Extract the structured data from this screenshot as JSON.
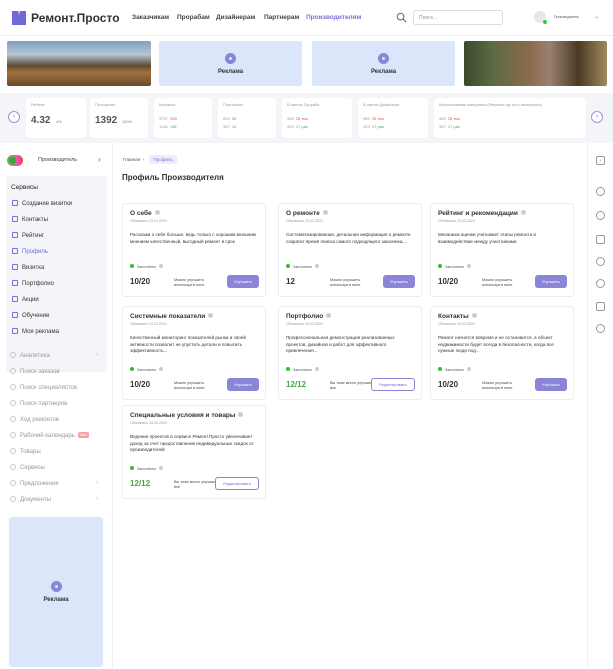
{
  "header": {
    "logo": "Ремонт.Просто",
    "nav": [
      "Заказчикам",
      "Прорабам",
      "Дизайнерам",
      "Партнерам",
      "Производителям"
    ],
    "active_nav": "Производителям",
    "search_placeholder": "Поиск...",
    "user_role": "Производитель"
  },
  "banners": {
    "ad_label": "Реклама"
  },
  "stats": [
    {
      "label": "Рейтинг",
      "value": "4.32",
      "delta": "4%"
    },
    {
      "label": "Посещения",
      "value": "1392",
      "delta": "100%"
    },
    {
      "label": "Контакты",
      "r1a": "3757",
      "r1b": "250",
      "r2a": "1136",
      "r2b": "136"
    },
    {
      "label": "Портфолио",
      "r1a": "804",
      "r1b": "30",
      "r2a": "397",
      "r2b": "14"
    },
    {
      "label": "В сметах Прораба",
      "r1a": "965",
      "r1b": "25 тыс",
      "r2a": "493",
      "r2b": "17 раз"
    },
    {
      "label": "В сметах Дизайнера",
      "r1a": "965",
      "r1b": "25 тыс",
      "r2a": "493",
      "r2b": "17 раз"
    },
    {
      "label": "Использование материала (Ремонты где есть материалы)",
      "r1a": "465",
      "r1b": "25 тыс",
      "r2a": "397",
      "r2b": "17 раз"
    }
  ],
  "sidebar": {
    "role": "Производитель",
    "services_title": "Сервисы",
    "services": [
      "Создание визитки",
      "Контакты",
      "Рейтинг",
      "Профиль",
      "Визитка",
      "Портфолио",
      "Акции",
      "Обучение",
      "Моя реклама"
    ],
    "menu": [
      "Аналитика",
      "Поиск заказов",
      "Поиск специалистов",
      "Поиск партнеров",
      "Ход ремонтов",
      "Рабочий календарь",
      "Товары",
      "Сервисы",
      "Предложения",
      "Документы"
    ],
    "new_badge": "New",
    "ad_label": "Реклама"
  },
  "main": {
    "breadcrumb_home": "Главная",
    "breadcrumb_current": "Профиль",
    "title": "Профиль Производителя"
  },
  "cards": [
    {
      "title": "О себе",
      "date": "Обновлено 23.03.2024",
      "text": "Расскажи о себе больше, ведь только с хорошим внешним мнением качественный, выгодный ремонт в срок",
      "status": "Заполнено",
      "score": "10/20",
      "note": "Можно улучшить используя в поле",
      "button": "Улучшить"
    },
    {
      "title": "О ремонте",
      "date": "Обновлено 23.03.2024",
      "text": "Систематизированная, детальная информация о ремонте сократит время поиска самого подходящего заказчика,...",
      "status": "Заполнено",
      "score": "12",
      "note": "Можно улучшить используя в поле",
      "button": "Улучшить"
    },
    {
      "title": "Рейтинг и рекомендации",
      "date": "Обновлено 23.03.2024",
      "text": "Механизм оценки учитывает этапы ремонта и взаимодействие между участниками",
      "status": "Заполнено",
      "score": "10/20",
      "note": "Можно улучшить используя в поле",
      "button": "Улучшить"
    },
    {
      "title": "Системные показатели",
      "date": "Обновлено 23.03.2024",
      "text": "Качественный мониторинг показателей рынка и своей активности позволит не упустить детали и повысить эффективность...",
      "status": "Заполнено",
      "score": "10/20",
      "note": "Можно улучшить используя в поле",
      "button": "Улучшить"
    },
    {
      "title": "Портфолио",
      "date": "Обновлено 23.03.2024",
      "text": "Профессиональная демонстрация реализованных проектов, дизайнов и работ для эффективного привлечения...",
      "status": "Заполнено",
      "score": "12/12",
      "note": "Вы тоже много улучшили все",
      "button": "Редактировать"
    },
    {
      "title": "Контакты",
      "date": "Обновлено 23.03.2024",
      "text": "Ремонт начнется вовремя и не остановится, а объект недвижимости будет всегда в безопасности, когда все нужные люди под...",
      "status": "Заполнено",
      "score": "10/20",
      "note": "Можно улучшить используя в поле",
      "button": "Улучшить"
    },
    {
      "title": "Специальные условия и товары",
      "date": "Обновлено 23.03.2024",
      "text": "Ведение проектов в сервисе Ремонт.Просто увеличивает доход за счет предоставления индивидуальных скидок от производителей",
      "status": "Заполнено",
      "score": "12/12",
      "note": "Вы тоже много улучшили все",
      "button": "Редактировать"
    }
  ]
}
